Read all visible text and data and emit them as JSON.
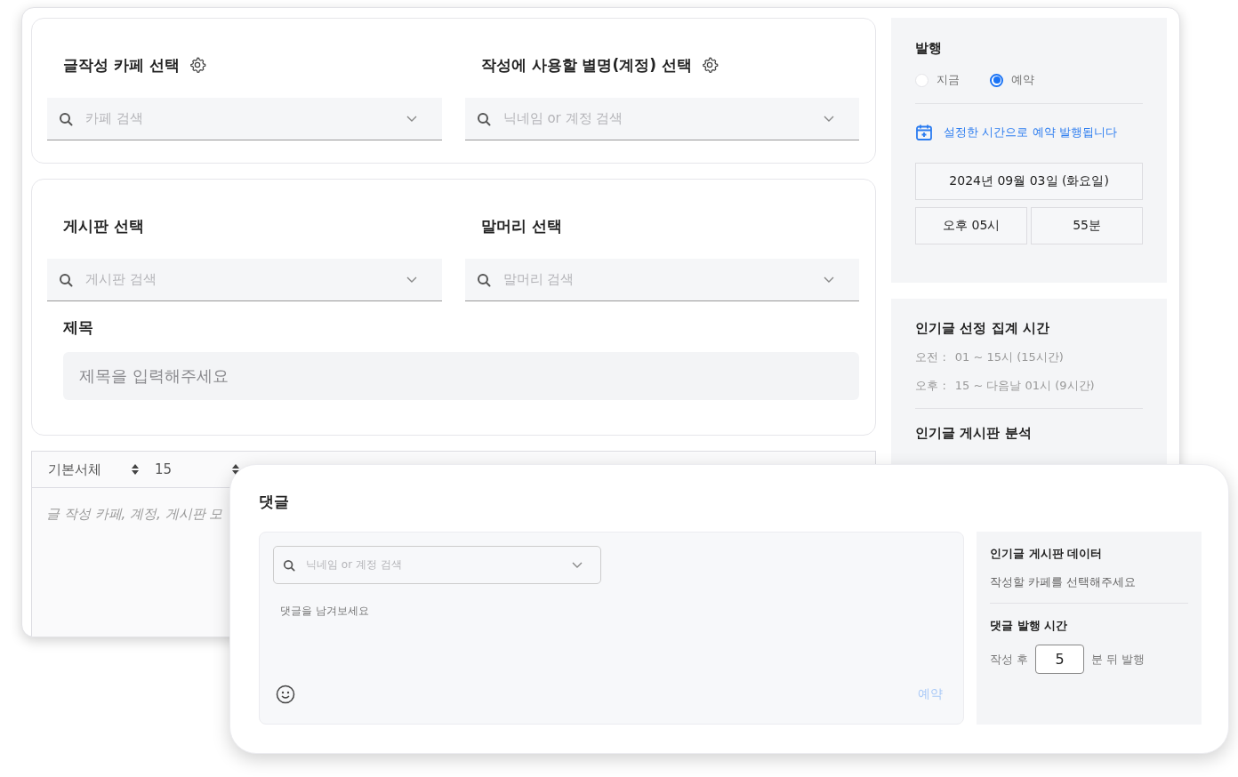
{
  "selects_top": [
    {
      "label": "글작성 카페 선택",
      "has_settings": true,
      "placeholder": "카페 검색"
    },
    {
      "label": "작성에 사용할 별명(계정) 선택",
      "has_settings": true,
      "placeholder": "닉네임 or 계정 검색"
    }
  ],
  "selects_board": [
    {
      "label": "게시판 선택",
      "has_settings": false,
      "placeholder": "게시판 검색"
    },
    {
      "label": "말머리 선택",
      "has_settings": false,
      "placeholder": "말머리 검색"
    }
  ],
  "title_field": {
    "label": "제목",
    "placeholder": "제목을 입력해주세요"
  },
  "editor": {
    "font": "기본서체",
    "size": "15",
    "placeholder": "글 작성 카페, 계정, 게시판 모"
  },
  "publish": {
    "title": "발행",
    "options": [
      {
        "label": "지금",
        "selected": false
      },
      {
        "label": "예약",
        "selected": true
      }
    ],
    "notice": "설정한 시간으로 예약 발행됩니다",
    "date": "2024년 09월 03일 (화요일)",
    "hour": "오후 05시",
    "minute": "55분"
  },
  "popular_time": {
    "title": "인기글 선정 집계 시간",
    "rows": [
      {
        "label": "오전 :",
        "value": "01 ~ 15시 (15시간)"
      },
      {
        "label": "오후 :",
        "value": "15 ~ 다음날 01시 (9시간)"
      }
    ]
  },
  "popular_analysis": {
    "title": "인기글 게시판 분석"
  },
  "comment": {
    "title": "댓글",
    "account_placeholder": "닉네임 or 계정 검색",
    "placeholder": "댓글을 남겨보세요",
    "submit": "예약",
    "submit_disabled": true,
    "side": {
      "data_title": "인기글 게시판 데이터",
      "data_text": "작성할 카페를 선택해주세요",
      "time_title": "댓글 발행 시간",
      "before": "작성 후",
      "minutes": "5",
      "after": "분 뒤 발행"
    }
  }
}
